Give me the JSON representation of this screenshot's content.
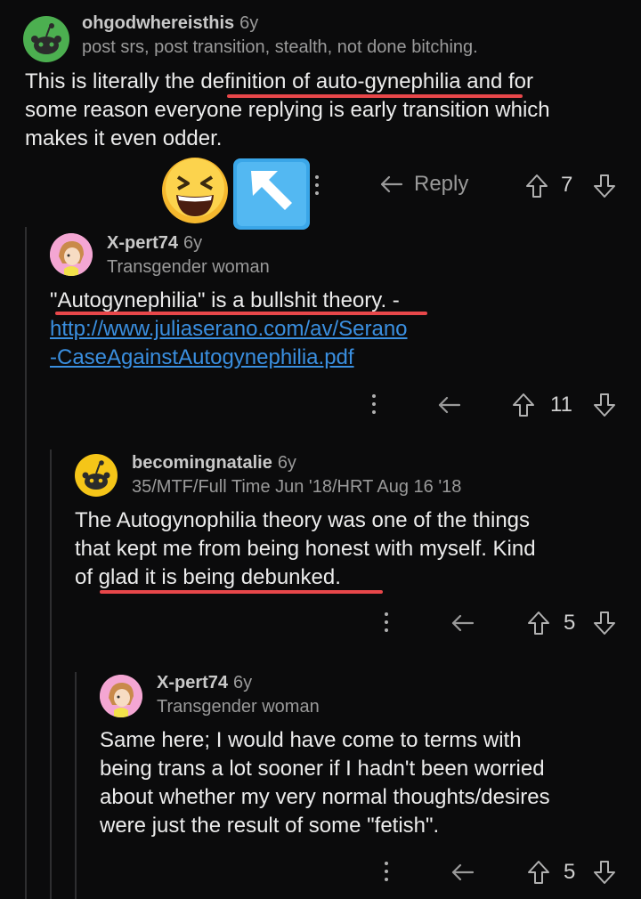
{
  "comments": [
    {
      "username": "ohgodwhereisthis",
      "age": "6y",
      "flair": "post srs, post transition, stealth, not done bitching.",
      "body": [
        "This is literally the definition of auto-gynephilia and for",
        "some reason everyone replying is early transition which",
        "makes it even odder."
      ],
      "reply_label": "Reply",
      "votes": "7"
    },
    {
      "username": "X-pert74",
      "age": "6y",
      "flair": "Transgender woman",
      "body_text": "\"Autogynephilia\" is a bullshit theory. -",
      "link_lines": [
        "http://www.juliaserano.com/av/Serano",
        "-CaseAgainstAutogynephilia.pdf"
      ],
      "votes": "11"
    },
    {
      "username": "becomingnatalie",
      "age": "6y",
      "flair": "35/MTF/Full Time Jun '18/HRT Aug 16 '18",
      "body": [
        "The Autogynophilia theory was one of the things",
        "that kept me from being honest with myself.  Kind",
        "of glad it is being debunked."
      ],
      "votes": "5"
    },
    {
      "username": "X-pert74",
      "age": "6y",
      "flair": "Transgender woman",
      "body": [
        "Same here; I would have come to terms with",
        "being trans a lot sooner if I hadn't been worried",
        "about whether my very normal thoughts/desires",
        "were just the result of some \"fetish\"."
      ],
      "votes": "5"
    }
  ],
  "colors": {
    "background": "#0b0b0c",
    "underline": "#e8474a",
    "link": "#3a8fe0",
    "avatar_alien": "#4caf50",
    "avatar_yellow": "#f5c518"
  },
  "emojis": [
    "laughing-squint-emoji",
    "up-left-arrow-emoji"
  ]
}
